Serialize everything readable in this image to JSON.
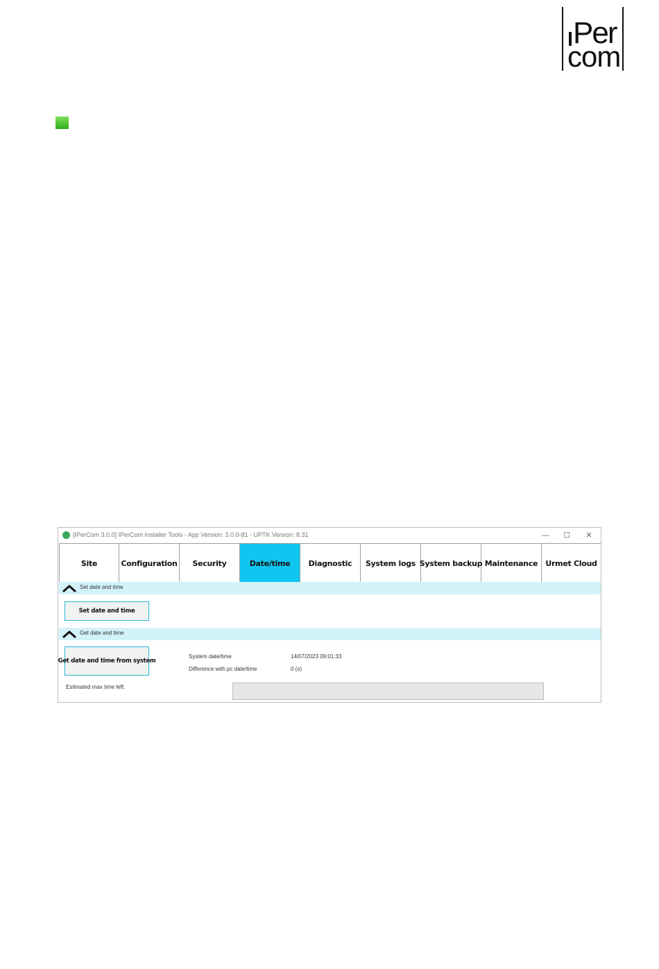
{
  "logo": {
    "line1": "Per",
    "line2": "com"
  },
  "window": {
    "title": "[IPerCom 3.0.0] IPerCom Installer Tools - App Version: 3.0.0-81 - UPTK Version: 8.31",
    "controls": {
      "minimize": "—",
      "maximize": "☐",
      "close": "✕"
    }
  },
  "tabs": [
    {
      "label": "Site"
    },
    {
      "label": "Configuration"
    },
    {
      "label": "Security"
    },
    {
      "label": "Date/time",
      "active": true
    },
    {
      "label": "Diagnostic"
    },
    {
      "label": "System logs"
    },
    {
      "label": "System backup"
    },
    {
      "label": "Maintenance"
    },
    {
      "label": "Urmet Cloud"
    }
  ],
  "set_section": {
    "header": "Set date and time",
    "button": "Set date and time"
  },
  "get_section": {
    "header": "Get date and time",
    "button": "Get date and time from system",
    "system_datetime_label": "System date/time",
    "system_datetime_value": "14/07/2023 09:01:33",
    "difference_label": "Difference with pc date/time",
    "difference_value": "0 (s)",
    "estimated_label": "Estimated max time left:",
    "progress_fraction": 0
  },
  "colors": {
    "active_tab": "#0fc6f0",
    "section_bar": "#d2f2fa",
    "button_border": "#25b8d6",
    "marker_green": "#3fbf2a"
  }
}
